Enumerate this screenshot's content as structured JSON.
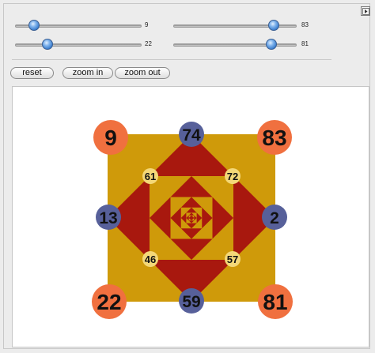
{
  "sliders": [
    {
      "value": "9",
      "fraction": 0.13
    },
    {
      "value": "83",
      "fraction": 0.9
    },
    {
      "value": "22",
      "fraction": 0.24
    },
    {
      "value": "81",
      "fraction": 0.88
    }
  ],
  "buttons": {
    "reset": "reset",
    "zoom_in": "zoom in",
    "zoom_out": "zoom out"
  },
  "square": {
    "corners": {
      "top_left": "9",
      "top_right": "83",
      "bottom_left": "22",
      "bottom_right": "81"
    },
    "edges": {
      "top": "74",
      "right": "2",
      "bottom": "59",
      "left": "13"
    },
    "inner": {
      "top_left": "61",
      "top_right": "72",
      "bottom_left": "46",
      "bottom_right": "57"
    }
  },
  "colors": {
    "gold": "#cf9a0a",
    "red": "#a8180e",
    "corner_circle": "#f0703f",
    "edge_circle": "#57609a",
    "inner_circle": "#f4d878"
  }
}
